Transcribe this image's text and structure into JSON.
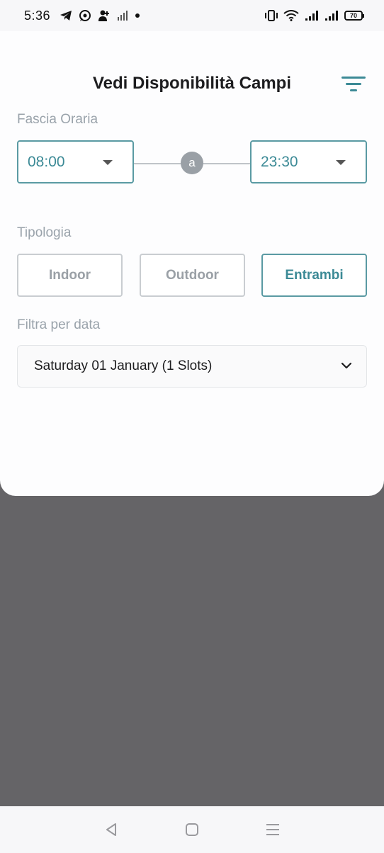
{
  "status_bar": {
    "time": "5:36",
    "left_icons": [
      "telegram-icon",
      "whatsapp-icon",
      "person-add-icon",
      "signal-off-icon",
      "dot-icon"
    ],
    "right_icons": [
      "vibrate-icon",
      "wifi-icon",
      "signal-icon",
      "signal-icon"
    ],
    "battery": "70"
  },
  "header": {
    "title": "Vedi Disponibilità Campi",
    "filter_icon": "filter-icon"
  },
  "time_range": {
    "label": "Fascia Oraria",
    "from": "08:00",
    "connector": "a",
    "to": "23:30"
  },
  "type": {
    "label": "Tipologia",
    "options": [
      "Indoor",
      "Outdoor",
      "Entrambi"
    ],
    "selected": "Entrambi"
  },
  "date_filter": {
    "label": "Filtra per data",
    "value": "Saturday 01 January (1 Slots)"
  },
  "colors": {
    "accent": "#3c8a96",
    "muted": "#9aa0a6",
    "backdrop": "#656467"
  },
  "nav": [
    "back-icon",
    "home-icon",
    "recents-icon"
  ]
}
